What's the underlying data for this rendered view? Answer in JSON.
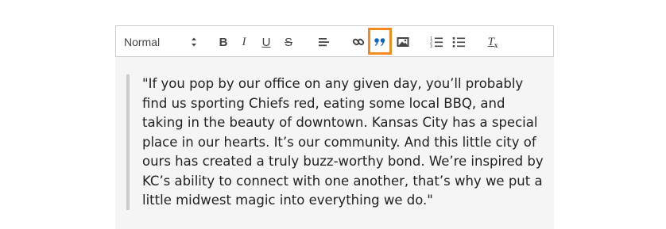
{
  "toolbar": {
    "format_select": {
      "value": "Normal"
    },
    "buttons": [
      {
        "name": "bold",
        "label": "B"
      },
      {
        "name": "italic",
        "label": "I"
      },
      {
        "name": "underline",
        "label": "U"
      },
      {
        "name": "strike",
        "label": "S"
      },
      {
        "name": "align",
        "icon": "align-left-icon"
      },
      {
        "name": "link",
        "icon": "link-icon"
      },
      {
        "name": "blockquote",
        "icon": "blockquote-icon",
        "active": true
      },
      {
        "name": "image",
        "icon": "image-icon"
      },
      {
        "name": "ordered-list",
        "icon": "ordered-list-icon"
      },
      {
        "name": "bullet-list",
        "icon": "bullet-list-icon"
      },
      {
        "name": "clean",
        "label": "T",
        "icon": "clear-formatting-icon"
      }
    ],
    "highlight_color": "#f28a1e",
    "active_icon_color": "#06c"
  },
  "editor": {
    "blockquote": "\"If you pop by our office on any given day, you’ll probably find us sporting Chiefs red, eating some local BBQ, and taking in the beauty of downtown. Kansas City has a special place in our hearts. It’s our community. And this little city of ours has created a truly buzz-worthy bond. We’re inspired by KC’s ability to connect with one another, that’s why we put a little midwest magic into everything we do.\""
  }
}
